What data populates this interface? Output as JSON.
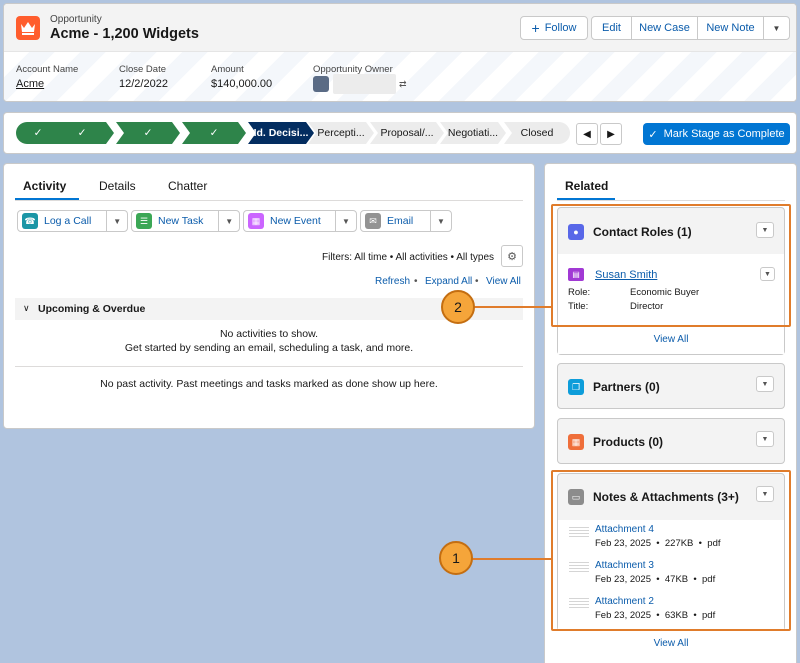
{
  "header": {
    "object_type": "Opportunity",
    "title": "Acme - 1,200 Widgets",
    "buttons": {
      "follow": "Follow",
      "edit": "Edit",
      "new_case": "New Case",
      "new_note": "New Note"
    },
    "fields": [
      {
        "label": "Account Name",
        "value": "Acme"
      },
      {
        "label": "Close Date",
        "value": "12/2/2022"
      },
      {
        "label": "Amount",
        "value": "$140,000.00"
      },
      {
        "label": "Opportunity Owner",
        "value": ""
      }
    ]
  },
  "path": {
    "stages": [
      "✓",
      "✓",
      "✓",
      "✓",
      "Id. Decisi...",
      "Percepti...",
      "Proposal/...",
      "Negotiati...",
      "Closed"
    ],
    "current_index": 4,
    "mark_complete": "Mark Stage as Complete",
    "colors": {
      "done": "#2e844a",
      "current": "#032d60",
      "todo": "#ececec"
    }
  },
  "activity": {
    "tabs": [
      "Activity",
      "Details",
      "Chatter"
    ],
    "actions": {
      "log_call": "Log a Call",
      "new_task": "New Task",
      "new_event": "New Event",
      "email": "Email"
    },
    "filters": "Filters: All time • All activities • All types",
    "links": {
      "refresh": "Refresh",
      "expand_all": "Expand All",
      "view_all": "View All"
    },
    "upcoming_header": "Upcoming & Overdue",
    "no_activities": "No activities to show.",
    "get_started": "Get started by sending an email, scheduling a task, and more.",
    "no_past": "No past activity. Past meetings and tasks marked as done show up here."
  },
  "related": {
    "tab": "Related",
    "contact_roles": {
      "title": "Contact Roles (1)",
      "name": "Susan Smith",
      "role_label": "Role:",
      "role": "Economic Buyer",
      "title_label": "Title:",
      "title_value": "Director",
      "view_all": "View All"
    },
    "partners": {
      "title": "Partners (0)"
    },
    "products": {
      "title": "Products (0)"
    },
    "notes": {
      "title": "Notes & Attachments (3+)",
      "items": [
        {
          "name": "Attachment 4",
          "meta": "Feb 23, 2025  •  227KB  •  pdf"
        },
        {
          "name": "Attachment 3",
          "meta": "Feb 23, 2025  •  47KB  •  pdf"
        },
        {
          "name": "Attachment 2",
          "meta": "Feb 23, 2025  •  63KB  •  pdf"
        }
      ],
      "view_all": "View All"
    }
  },
  "callouts": [
    "2",
    "1"
  ],
  "icons": {
    "opportunity": "crown-icon",
    "follow": "plus-icon",
    "gear": "gear-icon",
    "contact_roles": "contact-icon",
    "partners": "partners-icon",
    "products": "products-icon",
    "notes": "document-icon"
  }
}
